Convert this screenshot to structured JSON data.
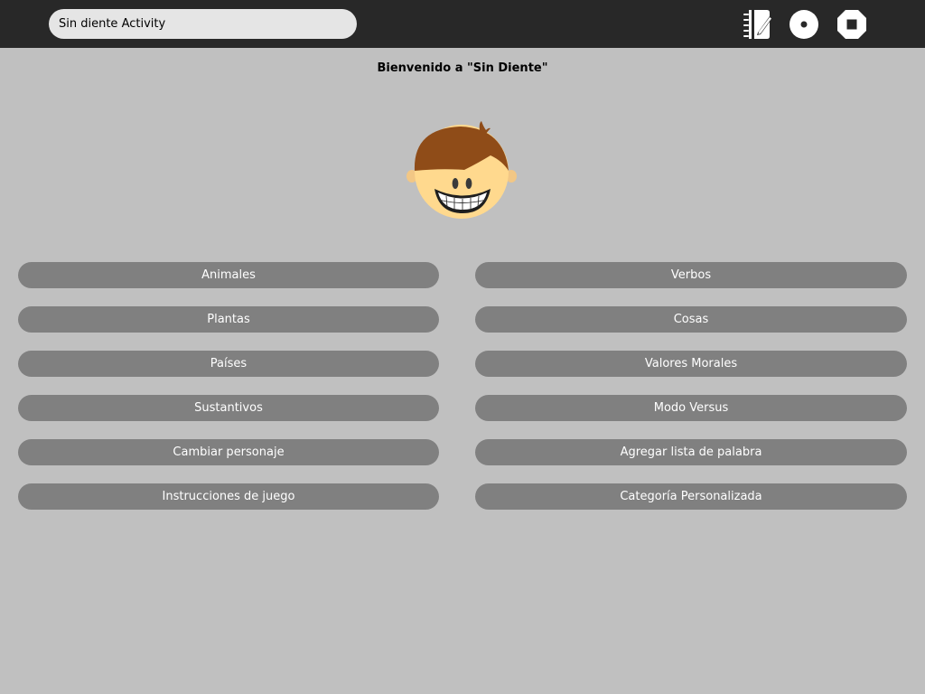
{
  "toolbar": {
    "activity_title": "Sin diente Activity",
    "icons": [
      "journal-icon",
      "share-icon",
      "stop-icon"
    ],
    "background_color": "#282828"
  },
  "welcome": {
    "text": "Bienvenido a \"Sin Diente\""
  },
  "menu": {
    "left": [
      "Animales",
      "Plantas",
      "Países",
      "Sustantivos",
      "Cambiar personaje",
      "Instrucciones de juego"
    ],
    "right": [
      "Verbos",
      "Cosas",
      "Valores Morales",
      "Modo Versus",
      "Agregar lista de palabra",
      "Categoría Personalizada"
    ],
    "button_color": "#808080"
  },
  "colors": {
    "background": "#c0c0c0",
    "hair": "#8f4c18",
    "skin": "#ffd98e"
  }
}
